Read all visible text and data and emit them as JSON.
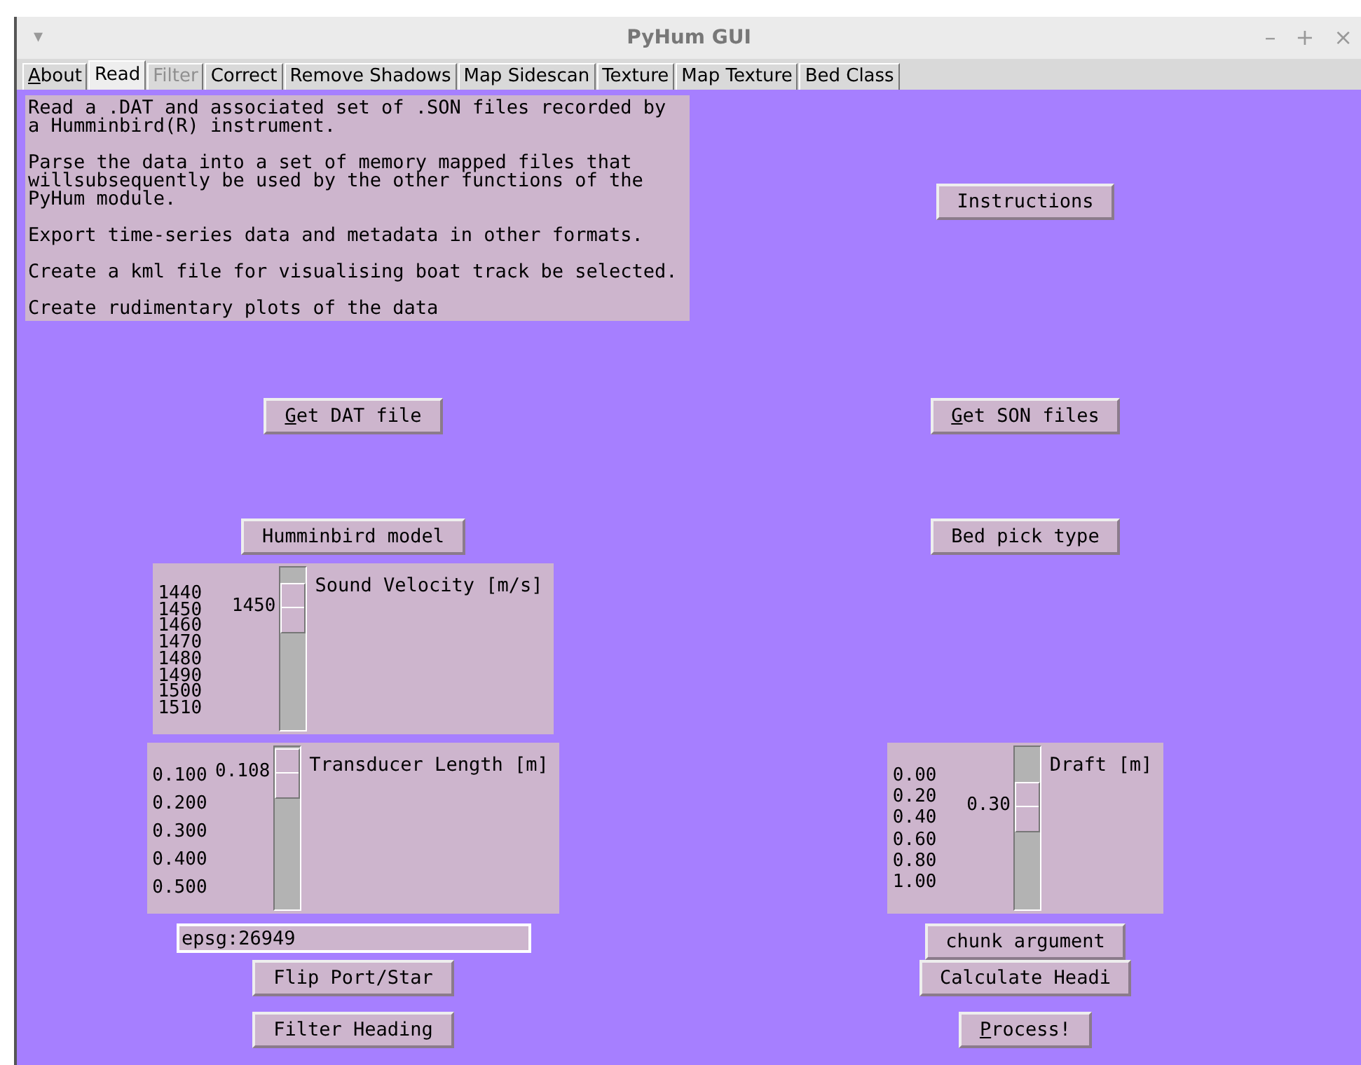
{
  "window": {
    "title": "PyHum GUI",
    "menu_glyph": "▾",
    "controls": [
      "–",
      "+",
      "×"
    ]
  },
  "tabs": [
    {
      "label": "About",
      "selected": false,
      "disabled": false,
      "underline_first": true
    },
    {
      "label": "Read",
      "selected": true,
      "disabled": false,
      "underline_first": false
    },
    {
      "label": "Filter",
      "selected": false,
      "disabled": true,
      "underline_first": false
    },
    {
      "label": "Correct",
      "selected": false,
      "disabled": false,
      "underline_first": false
    },
    {
      "label": "Remove Shadows",
      "selected": false,
      "disabled": false,
      "underline_first": false
    },
    {
      "label": "Map Sidescan",
      "selected": false,
      "disabled": false,
      "underline_first": false
    },
    {
      "label": "Texture",
      "selected": false,
      "disabled": false,
      "underline_first": false
    },
    {
      "label": "Map Texture",
      "selected": false,
      "disabled": false,
      "underline_first": false
    },
    {
      "label": "Bed Class",
      "selected": false,
      "disabled": false,
      "underline_first": false
    }
  ],
  "rows": [
    {
      "left": {
        "kind": "text",
        "paragraphs": [
          "Read a .DAT and associated set of .SON files recorded by a Humminbird(R) instrument.",
          "Parse the data into a set of memory mapped files that willsubsequently be used by the other functions of the PyHum module.",
          "Export time-series data and metadata in other formats.",
          "Create a kml file for visualising boat track be selected.",
          "Create rudimentary plots of the data"
        ]
      },
      "right": {
        "kind": "button",
        "label": "Instructions",
        "underline_first": false
      }
    },
    {
      "left": {
        "kind": "button",
        "label": "Get DAT file",
        "underline_first": true
      },
      "right": {
        "kind": "button",
        "label": "Get SON files",
        "underline_first": true
      }
    },
    {
      "left": {
        "kind": "button",
        "label": "Humminbird model",
        "underline_first": false
      },
      "right": {
        "kind": "button",
        "label": "Bed pick type",
        "underline_first": false
      }
    },
    {
      "left": {
        "kind": "scale",
        "label": "Sound Velocity [m/s]",
        "value": "1450",
        "ticks": [
          "1440",
          "1450",
          "1460",
          "1470",
          "1480",
          "1490",
          "1500",
          "1510"
        ],
        "level": 0.13
      }
    },
    {
      "left": {
        "kind": "scale",
        "label": "Transducer Length [m]",
        "value": "0.108",
        "ticks": [
          "0.100",
          "0.200",
          "0.300",
          "0.400",
          "0.500"
        ],
        "level": 0.01
      },
      "right": {
        "kind": "scale",
        "label": "Draft [m]",
        "value": "0.30",
        "ticks": [
          "0.00",
          "0.20",
          "0.40",
          "0.60",
          "0.80",
          "1.00"
        ],
        "level": 0.3
      }
    },
    {
      "left": {
        "kind": "entry",
        "value": "epsg:26949"
      },
      "right": {
        "kind": "button",
        "label": "chunk argument",
        "underline_first": false
      }
    },
    {
      "left": {
        "kind": "button",
        "label": "Flip Port/Star",
        "underline_first": false
      },
      "right": {
        "kind": "button",
        "label": "Calculate Headi",
        "underline_first": false
      }
    },
    {
      "left": {
        "kind": "button",
        "label": "Filter Heading",
        "underline_first": false
      },
      "right": {
        "kind": "button",
        "label": "Process!",
        "underline_first": true
      }
    }
  ]
}
